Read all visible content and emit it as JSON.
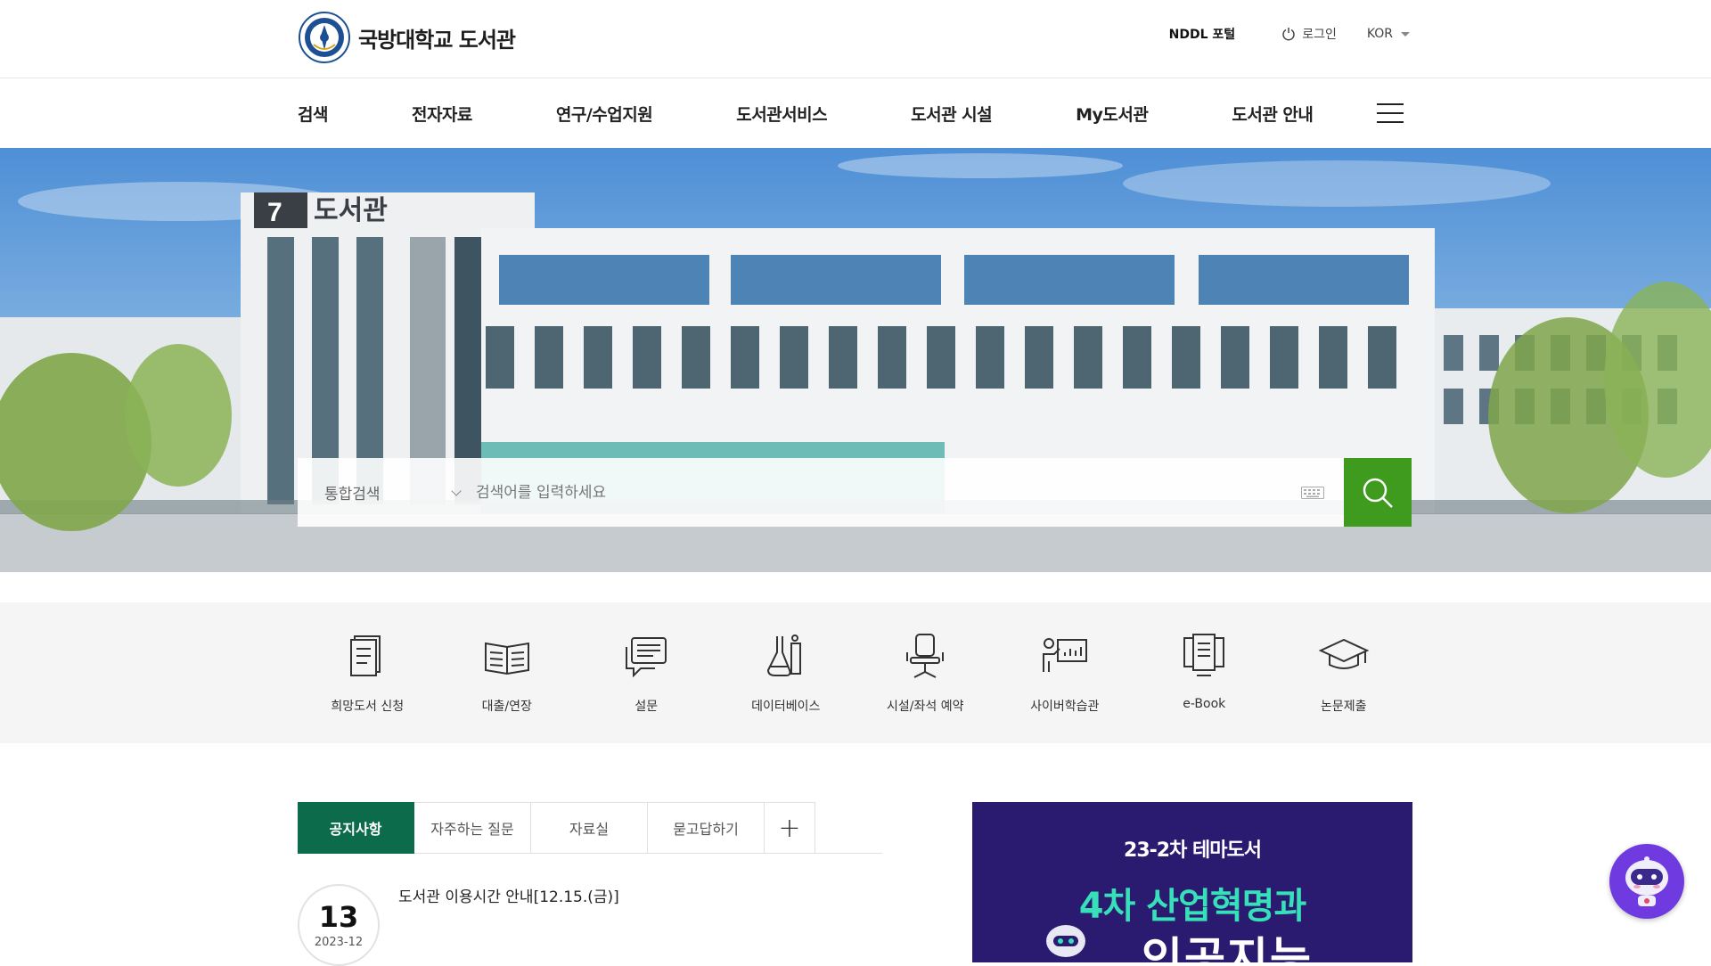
{
  "header": {
    "site_title": "국방대학교 도서관",
    "portal_link": "NDDL 포털",
    "login_label": "로그인",
    "language": "KOR"
  },
  "nav": {
    "items": [
      "검색",
      "전자자료",
      "연구/수업지원",
      "도서관서비스",
      "도서관 시설",
      "My도서관",
      "도서관 안내"
    ]
  },
  "hero": {
    "building_sign": "도서관",
    "building_number": "7"
  },
  "search": {
    "scope": "통합검색",
    "placeholder": "검색어를 입력하세요"
  },
  "quick_links": [
    {
      "label": "희망도서 신청",
      "icon": "request-book-icon"
    },
    {
      "label": "대출/연장",
      "icon": "open-book-icon"
    },
    {
      "label": "설문",
      "icon": "chat-survey-icon"
    },
    {
      "label": "데이터베이스",
      "icon": "flask-icon"
    },
    {
      "label": "시설/좌석 예약",
      "icon": "chair-icon"
    },
    {
      "label": "사이버학습관",
      "icon": "presentation-icon"
    },
    {
      "label": "e-Book",
      "icon": "ebook-monitor-icon"
    },
    {
      "label": "논문제출",
      "icon": "graduation-cap-icon"
    }
  ],
  "board": {
    "tabs": [
      "공지사항",
      "자주하는 질문",
      "자료실",
      "묻고답하기"
    ],
    "more_label": "+",
    "latest": {
      "day": "13",
      "year_month": "2023-12",
      "title": "도서관 이용시간 안내[12.15.(금)]"
    }
  },
  "banner": {
    "line1": "23-2차 테마도서",
    "line2": "4차 산업혁명과",
    "line3": "인공지능"
  },
  "colors": {
    "accent_green": "#0c6b4a",
    "search_button": "#3f9b1e",
    "banner_bg": "#2a1a70",
    "banner_title": "#37e0b8",
    "chatbot": "#6f3ae0"
  }
}
